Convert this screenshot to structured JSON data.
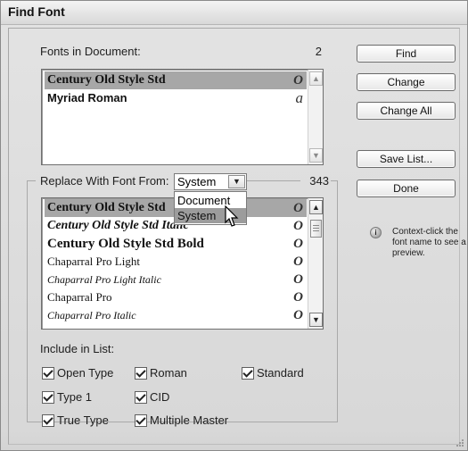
{
  "window": {
    "title": "Find Font"
  },
  "fonts_in_document": {
    "label": "Fonts in Document:",
    "count": "2",
    "items": [
      {
        "name": "Century Old Style Std",
        "glyph": "O",
        "selected": true
      },
      {
        "name": "Myriad Roman",
        "glyph": "a",
        "selected": false
      }
    ]
  },
  "replace": {
    "label": "Replace With Font From:",
    "selected": "System",
    "count": "343",
    "options": [
      "Document",
      "System"
    ],
    "highlighted_option": "System",
    "items": [
      {
        "name": "Century Old Style Std",
        "glyph": "O",
        "style": "bold",
        "selected": true
      },
      {
        "name": "Century Old Style Std Italic",
        "glyph": "O",
        "style": "bold-italic"
      },
      {
        "name": "Century Old Style Std Bold",
        "glyph": "O",
        "style": "bold"
      },
      {
        "name": "Chaparral Pro Light",
        "glyph": "O",
        "style": "normal"
      },
      {
        "name": "Chaparral Pro Light Italic",
        "glyph": "O",
        "style": "italic"
      },
      {
        "name": "Chaparral Pro",
        "glyph": "O",
        "style": "normal"
      },
      {
        "name": "Chaparral Pro Italic",
        "glyph": "O",
        "style": "italic"
      }
    ]
  },
  "include": {
    "label": "Include in List:",
    "options": [
      {
        "label": "Open Type",
        "checked": true
      },
      {
        "label": "Roman",
        "checked": true
      },
      {
        "label": "Standard",
        "checked": true
      },
      {
        "label": "Type 1",
        "checked": true
      },
      {
        "label": "CID",
        "checked": true
      },
      {
        "label": "True Type",
        "checked": true
      },
      {
        "label": "Multiple Master",
        "checked": true
      }
    ]
  },
  "buttons": {
    "find": "Find",
    "change": "Change",
    "change_all": "Change All",
    "save_list": "Save List...",
    "done": "Done"
  },
  "hint": {
    "text": "Context-click the font name to see a preview.",
    "icon": "info-icon"
  },
  "colors": {
    "selection": "#a7a7a7",
    "background": "#e3e3e3"
  }
}
